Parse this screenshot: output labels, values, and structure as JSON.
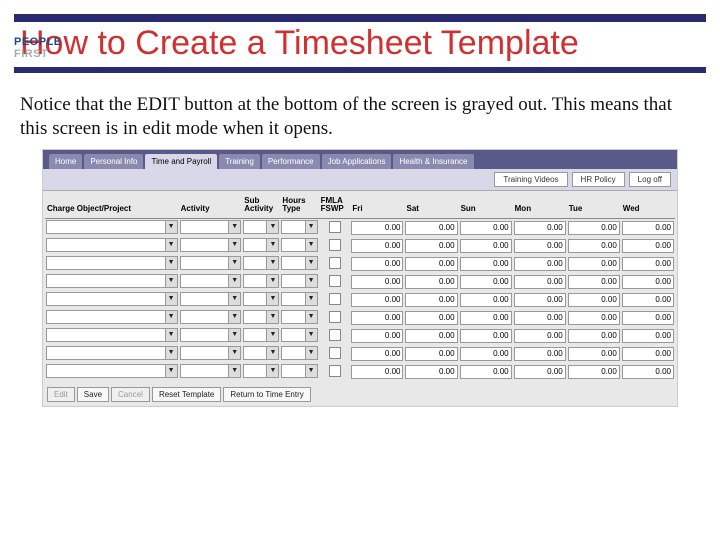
{
  "logo": {
    "line1": "PEOPLE",
    "line2": "FIRST"
  },
  "title": "How to Create a Timesheet Template",
  "body": "Notice that the EDIT button at the bottom of the screen is grayed out. This means that this screen is in edit mode when it opens.",
  "nav": {
    "tabs": [
      "Home",
      "Personal Info",
      "Time and Payroll",
      "Training",
      "Performance",
      "Job Applications",
      "Health & Insurance"
    ],
    "activeIndex": 2,
    "rightButtons": [
      "Training Videos",
      "HR Policy",
      "Log off"
    ]
  },
  "grid": {
    "headers": {
      "charge": "Charge Object/Project",
      "activity": "Activity",
      "sub": "Sub Activity",
      "hours": "Hours Type",
      "fmla": "FMLA FSWP",
      "days": [
        "Fri",
        "Sat",
        "Sun",
        "Mon",
        "Tue",
        "Wed"
      ]
    },
    "dayCellDefault": "0.00",
    "rowCount": 9
  },
  "bottomButtons": [
    {
      "label": "Edit",
      "disabled": true
    },
    {
      "label": "Save",
      "disabled": false
    },
    {
      "label": "Cancel",
      "disabled": true
    },
    {
      "label": "Reset Template",
      "disabled": false
    },
    {
      "label": "Return to Time Entry",
      "disabled": false
    }
  ]
}
